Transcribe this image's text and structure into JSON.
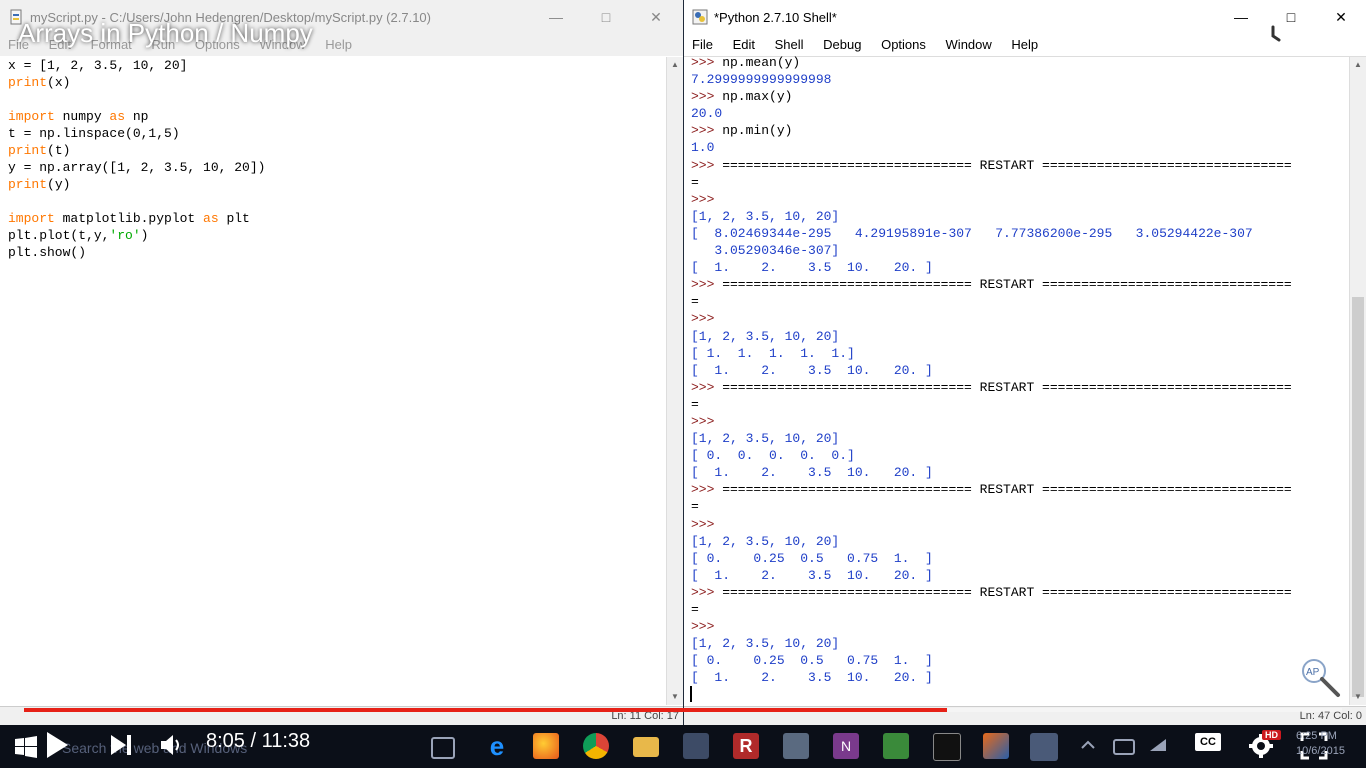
{
  "editor": {
    "title": "myScript.py - C:/Users/John Hedengren/Desktop/myScript.py (2.7.10)",
    "menu": [
      "File",
      "Edit",
      "Format",
      "Run",
      "Options",
      "Window",
      "Help"
    ],
    "code_lines": [
      "x = [1, 2, 3.5, 10, 20]",
      "print(x)",
      "",
      "import numpy as np",
      "t = np.linspace(0,1,5)",
      "print(t)",
      "y = np.array([1, 2, 3.5, 10, 20])",
      "print(y)",
      "",
      "import matplotlib.pyplot as plt",
      "plt.plot(t,y,'ro')",
      "plt.show()"
    ],
    "status": "Ln: 11 Col: 17"
  },
  "shell": {
    "title": "*Python 2.7.10 Shell*",
    "menu": [
      "File",
      "Edit",
      "Shell",
      "Debug",
      "Options",
      "Window",
      "Help"
    ],
    "lines": [
      {
        "t": ">>> np.mean(y)",
        "c": "cmd"
      },
      {
        "t": "7.2999999999999998",
        "c": "out"
      },
      {
        "t": ">>> np.max(y)",
        "c": "cmd"
      },
      {
        "t": "20.0",
        "c": "out"
      },
      {
        "t": ">>> np.min(y)",
        "c": "cmd"
      },
      {
        "t": "1.0",
        "c": "out"
      },
      {
        "t": ">>> ================================ RESTART ================================",
        "c": "restart"
      },
      {
        "t": "=",
        "c": "plain"
      },
      {
        "t": ">>>",
        "c": "prompt"
      },
      {
        "t": "[1, 2, 3.5, 10, 20]",
        "c": "out"
      },
      {
        "t": "[  8.02469344e-295   4.29195891e-307   7.77386200e-295   3.05294422e-307",
        "c": "out"
      },
      {
        "t": "   3.05290346e-307]",
        "c": "out"
      },
      {
        "t": "[  1.    2.    3.5  10.   20. ]",
        "c": "out"
      },
      {
        "t": ">>> ================================ RESTART ================================",
        "c": "restart"
      },
      {
        "t": "=",
        "c": "plain"
      },
      {
        "t": ">>>",
        "c": "prompt"
      },
      {
        "t": "[1, 2, 3.5, 10, 20]",
        "c": "out"
      },
      {
        "t": "[ 1.  1.  1.  1.  1.]",
        "c": "out"
      },
      {
        "t": "[  1.    2.    3.5  10.   20. ]",
        "c": "out"
      },
      {
        "t": ">>> ================================ RESTART ================================",
        "c": "restart"
      },
      {
        "t": "=",
        "c": "plain"
      },
      {
        "t": ">>>",
        "c": "prompt"
      },
      {
        "t": "[1, 2, 3.5, 10, 20]",
        "c": "out"
      },
      {
        "t": "[ 0.  0.  0.  0.  0.]",
        "c": "out"
      },
      {
        "t": "[  1.    2.    3.5  10.   20. ]",
        "c": "out"
      },
      {
        "t": ">>> ================================ RESTART ================================",
        "c": "restart"
      },
      {
        "t": "=",
        "c": "plain"
      },
      {
        "t": ">>>",
        "c": "prompt"
      },
      {
        "t": "[1, 2, 3.5, 10, 20]",
        "c": "out"
      },
      {
        "t": "[ 0.    0.25  0.5   0.75  1.  ]",
        "c": "out"
      },
      {
        "t": "[  1.    2.    3.5  10.   20. ]",
        "c": "out"
      },
      {
        "t": ">>> ================================ RESTART ================================",
        "c": "restart"
      },
      {
        "t": "=",
        "c": "plain"
      },
      {
        "t": ">>>",
        "c": "prompt"
      },
      {
        "t": "[1, 2, 3.5, 10, 20]",
        "c": "out"
      },
      {
        "t": "[ 0.    0.25  0.5   0.75  1.  ]",
        "c": "out"
      },
      {
        "t": "[  1.    2.    3.5  10.   20. ]",
        "c": "out"
      }
    ],
    "status": "Ln: 47 Col: 0"
  },
  "video": {
    "title": "Arrays in Python / Numpy",
    "time": "8:05 / 11:38",
    "progress": 0.7,
    "progress_color": "#e62117",
    "cc_label": "CC",
    "hd_label": "HD"
  },
  "taskbar": {
    "search_placeholder": "Search the web and Windows",
    "clock_time": "6:25 PM",
    "clock_date": "10/6/2015"
  },
  "colors": {
    "keyword": "#ff7700",
    "string": "#00aa00",
    "shell_output": "#1f3fc8",
    "prompt": "#8b1c1c"
  }
}
